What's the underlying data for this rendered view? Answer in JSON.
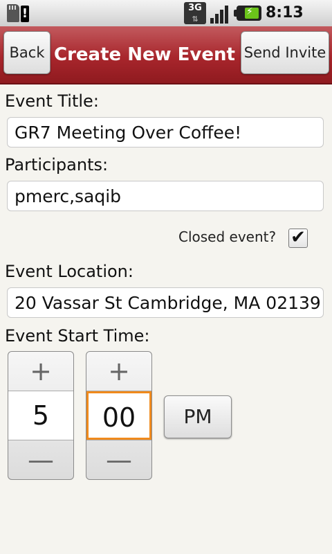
{
  "status_bar": {
    "time": "8:13 PM",
    "network": "3G",
    "icons": [
      "sd-card-icon",
      "warning-icon",
      "3g-icon",
      "signal-icon",
      "battery-charging-icon"
    ]
  },
  "title_bar": {
    "back_label": "Back",
    "title": "Create New Event",
    "send_label": "Send Invite",
    "colors": {
      "bar": "#a8262c",
      "text": "#ffffff"
    }
  },
  "form": {
    "event_title_label": "Event Title:",
    "event_title_value": "GR7 Meeting Over Coffee!",
    "participants_label": "Participants:",
    "participants_value": "pmerc,saqib",
    "closed_label": "Closed event?",
    "closed_checked": true,
    "closed_mark": "✔",
    "location_label": "Event Location:",
    "location_value": "20 Vassar St Cambridge, MA 02139",
    "start_time_label": "Event Start Time:"
  },
  "time_picker": {
    "hour": "5",
    "minute": "00",
    "ampm": "PM",
    "increment_symbol": "+",
    "decrement_symbol": "—",
    "focus_color": "#f08a1c"
  }
}
